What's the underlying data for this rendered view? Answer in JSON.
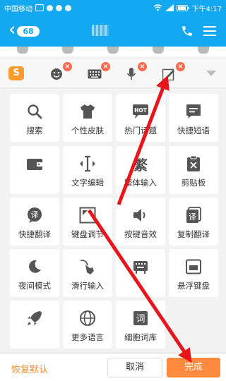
{
  "status_bar": {
    "carrier": "中国移动",
    "time": "下午4:17"
  },
  "header": {
    "unread_count": "68"
  },
  "toolbar": {
    "items": [
      {
        "name": "emoji",
        "badge": "×"
      },
      {
        "name": "keyboard",
        "badge": "×"
      },
      {
        "name": "voice",
        "badge": "×"
      },
      {
        "name": "handwrite",
        "badge": "×"
      }
    ],
    "logo_char": "S"
  },
  "grid": {
    "items": [
      {
        "label": "搜索",
        "icon": "search-icon"
      },
      {
        "label": "个性皮肤",
        "icon": "tshirt-icon"
      },
      {
        "label": "热门话题",
        "icon": "hot-topic-icon"
      },
      {
        "label": "快捷短语",
        "icon": "quick-phrase-icon"
      },
      {
        "label": "",
        "icon": "wallet-icon"
      },
      {
        "label": "文字编辑",
        "icon": "text-cursor-icon"
      },
      {
        "label": "繁体输入",
        "icon": "traditional-icon"
      },
      {
        "label": "剪贴板",
        "icon": "clipboard-icon"
      },
      {
        "label": "快捷翻译",
        "icon": "translate-bubble-icon"
      },
      {
        "label": "键盘调节",
        "icon": "keyboard-adjust-icon"
      },
      {
        "label": "按键音效",
        "icon": "speaker-icon"
      },
      {
        "label": "复制翻译",
        "icon": "copy-translate-icon"
      },
      {
        "label": "夜间模式",
        "icon": "moon-icon"
      },
      {
        "label": "滑行输入",
        "icon": "swipe-icon"
      },
      {
        "label": "",
        "icon": "keyboard-bag-icon"
      },
      {
        "label": "悬浮键盘",
        "icon": "float-keyboard-icon"
      },
      {
        "label": "",
        "icon": "rocket-icon"
      },
      {
        "label": "更多语言",
        "icon": "globe-icon"
      },
      {
        "label": "细胞词库",
        "icon": "cell-dict-icon"
      }
    ],
    "traditional_glyph": "繁",
    "translate_glyph": "译",
    "dict_glyph": "词",
    "hot_glyph": "HOT"
  },
  "bottom": {
    "restore_label": "恢复默认",
    "cancel_label": "取消",
    "done_label": "完成"
  },
  "colors": {
    "accent_blue": "#14a8f0",
    "orange": "#ff8a3d",
    "annotation_red": "#e8151b"
  }
}
